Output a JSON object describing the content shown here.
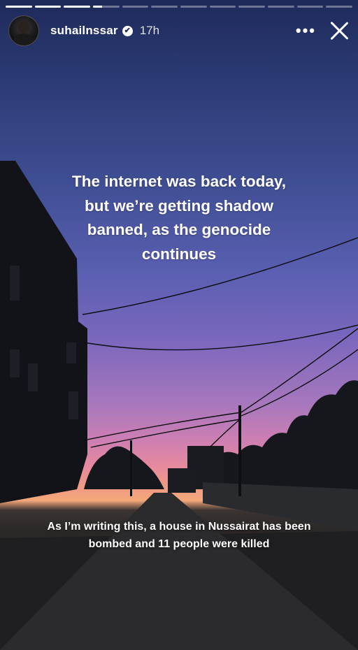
{
  "story": {
    "progress_segments": [
      1,
      1,
      1,
      0.35,
      0,
      0,
      0,
      0,
      0,
      0,
      0,
      0
    ],
    "username": "suhailnssar",
    "time_ago": "17h",
    "verified_icon": "✔",
    "more_icon": "•••",
    "caption_main": "The internet was back today, but we’re getting shadow banned, as the genocide continues",
    "caption_bottom": "As I’m writing this, a house in Nussairat has been bombed and 11 people were killed"
  }
}
